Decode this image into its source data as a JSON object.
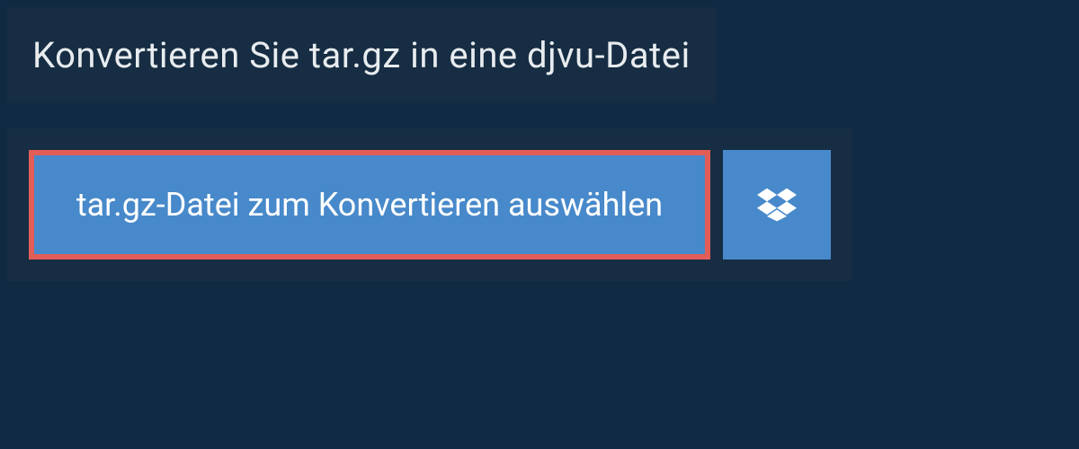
{
  "header": {
    "title": "Konvertieren Sie tar.gz in eine djvu-Datei"
  },
  "upload": {
    "select_button_label": "tar.gz-Datei zum Konvertieren auswählen",
    "dropbox_icon": "dropbox-icon"
  }
}
